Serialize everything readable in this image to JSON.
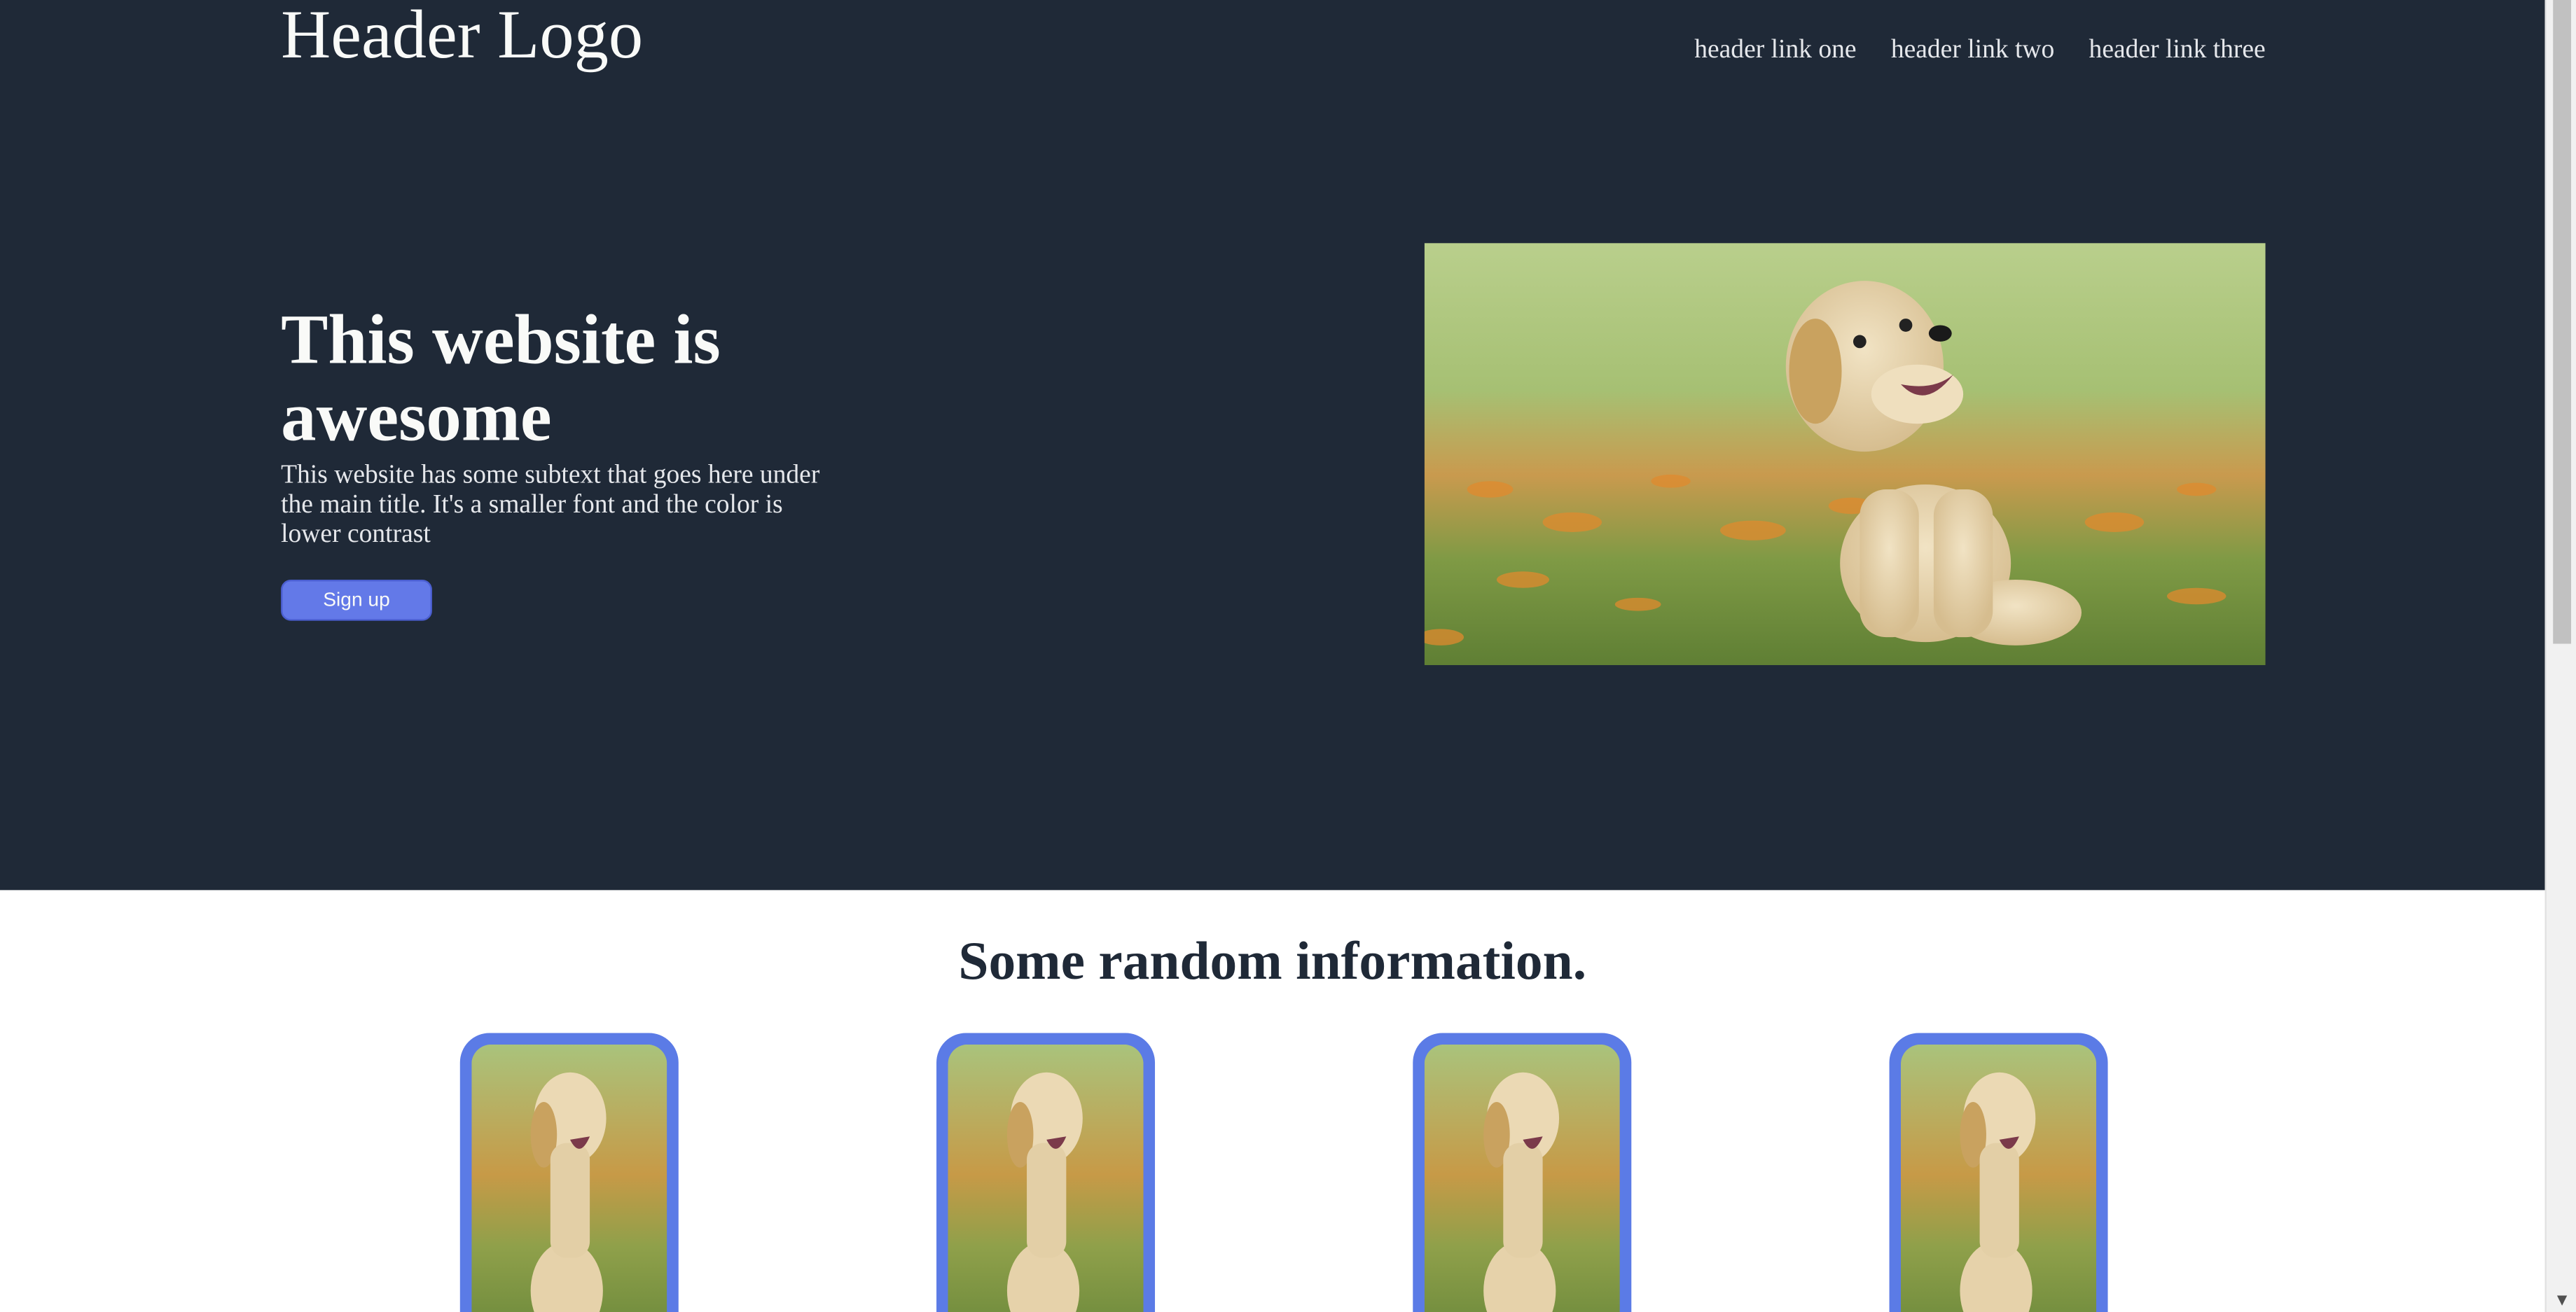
{
  "header": {
    "logo": "Header Logo",
    "links": [
      "header link one",
      "header link two",
      "header link three"
    ]
  },
  "hero": {
    "title": "This website is awesome",
    "subtext": "This website has some subtext that goes here under the main title. It's a smaller font and the color is lower contrast",
    "cta_label": "Sign up",
    "image_icon": "puppy-photo"
  },
  "info": {
    "title": "Some random information.",
    "cards": [
      {
        "image_icon": "puppy-photo"
      },
      {
        "image_icon": "puppy-photo"
      },
      {
        "image_icon": "puppy-photo"
      },
      {
        "image_icon": "puppy-photo"
      }
    ]
  },
  "colors": {
    "hero_bg": "#1f2937",
    "accent": "#6379e8",
    "card_border": "#5b7be6",
    "text_light": "#f9faf8",
    "text_dark": "#1f2937"
  },
  "scrollbar": {
    "down_arrow_icon": "chevron-down-icon"
  }
}
